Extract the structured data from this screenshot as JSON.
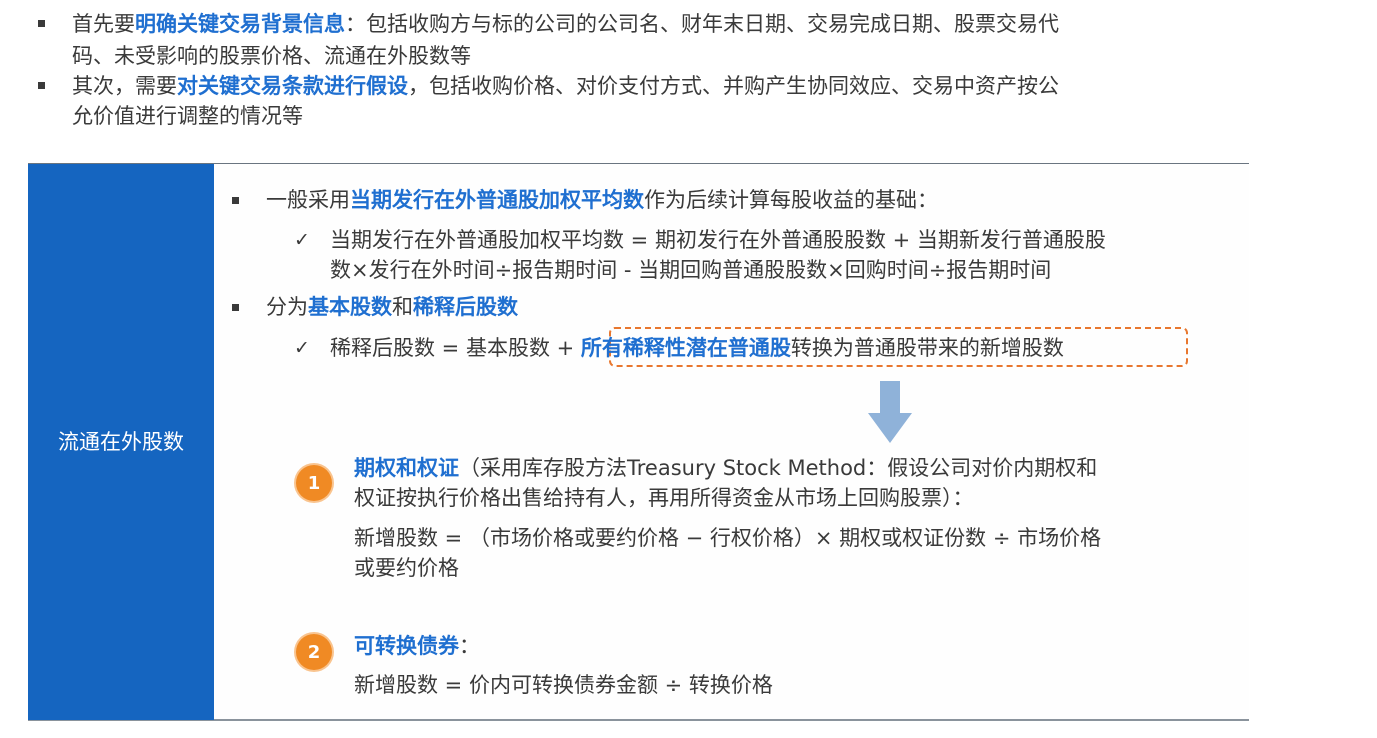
{
  "intro": [
    {
      "line1_prefix": "首先要",
      "line1_highlight": "明确关键交易背景信息",
      "line1_suffix": "：包括收购方与标的公司的公司名、财年末日期、交易完成日期、股票交易代",
      "line2": "码、未受影响的股票价格、流通在外股数等"
    },
    {
      "line1_prefix": "其次，需要",
      "line1_highlight": "对关键交易条款进行假设",
      "line1_suffix": "，包括收购价格、对价支付方式、并购产生协同效应、交易中资产按公",
      "line2": "允价值进行调整的情况等"
    }
  ],
  "sidebar": {
    "label": "流通在外股数"
  },
  "content": {
    "point1": {
      "prefix": "一般采用",
      "highlight": "当期发行在外普通股加权平均数",
      "suffix": "作为后续计算每股收益的基础："
    },
    "point1_sub": {
      "check": "✓",
      "line1": "当期发行在外普通股加权平均数 = 期初发行在外普通股股数 + 当期新发行普通股股",
      "line2": "数×发行在外时间÷报告期时间 - 当期回购普通股股数×回购时间÷报告期时间"
    },
    "point2": {
      "prefix": "分为",
      "highlight1": "基本股数",
      "mid": "和",
      "highlight2": "稀释后股数"
    },
    "point2_sub": {
      "check": "✓",
      "prefix": "稀释后股数 = 基本股数 + ",
      "highlight": "所有稀释性潜在普通股",
      "suffix": "转换为普通股带来的新增股数"
    }
  },
  "items": [
    {
      "number": "1",
      "title": "期权和权证",
      "head_rest_line1": "（采用库存股方法Treasury Stock Method：假设公司对价内期权和",
      "head_line2": "权证按执行价格出售给持有人，再用所得资金从市场上回购股票）：",
      "body_line1": "新增股数 = （市场价格或要约价格 − 行权价格）× 期权或权证份数 ÷ 市场价格",
      "body_line2": "或要约价格"
    },
    {
      "number": "2",
      "title": "可转换债券",
      "head_rest_line1": "：",
      "body_line1": "新增股数 = 价内可转换债券金额 ÷ 转换价格"
    }
  ],
  "colors": {
    "sidebar": "#1565c0",
    "highlight": "#1f6fd0",
    "number_badge": "#f08a24",
    "dashed_border": "#e8772e",
    "arrow": "#8fb2d9"
  },
  "icons": [
    "down-arrow-icon",
    "number-badge-icon"
  ]
}
